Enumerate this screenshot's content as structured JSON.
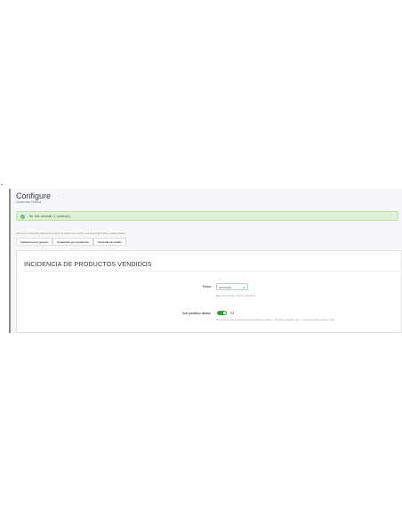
{
  "header": {
    "title": "Configure",
    "subtitle": "Incidencias Pedidos"
  },
  "alert": {
    "icon": "check-circle-icon",
    "message": "Se han enviado 1 correo(s)."
  },
  "help_text": "Seleccione el tipo de incidencia que quiere consultar o los cambios a revisar el historial de emails enviados.",
  "tabs": [
    {
      "label": "Incidencia por grupos"
    },
    {
      "label": "Incidencia por productos"
    },
    {
      "label": "Historial de emails"
    }
  ],
  "panel": {
    "title": "INCIDENCIA DE PRODUCTOS VENDIDOS",
    "fecha": {
      "label": "Fecha",
      "value": "04/07/2024",
      "icon": "calendar-icon",
      "hint": "Elige una fecha que sea hoy, o la anterior."
    },
    "solo_pedidos": {
      "label": "Solo pedidos válidos",
      "toggle_on": true,
      "toggle_label": "SÍ",
      "hint": "Si está activo, solo se tienen en cuenta pedidos con valid = 1. Si guarda el cambio: valid = 0 es perfecto para pruebas o evitar"
    }
  },
  "colors": {
    "alert_bg": "#dff0d8",
    "alert_icon": "#70b580",
    "toggle_on": "#3a9a4a"
  }
}
